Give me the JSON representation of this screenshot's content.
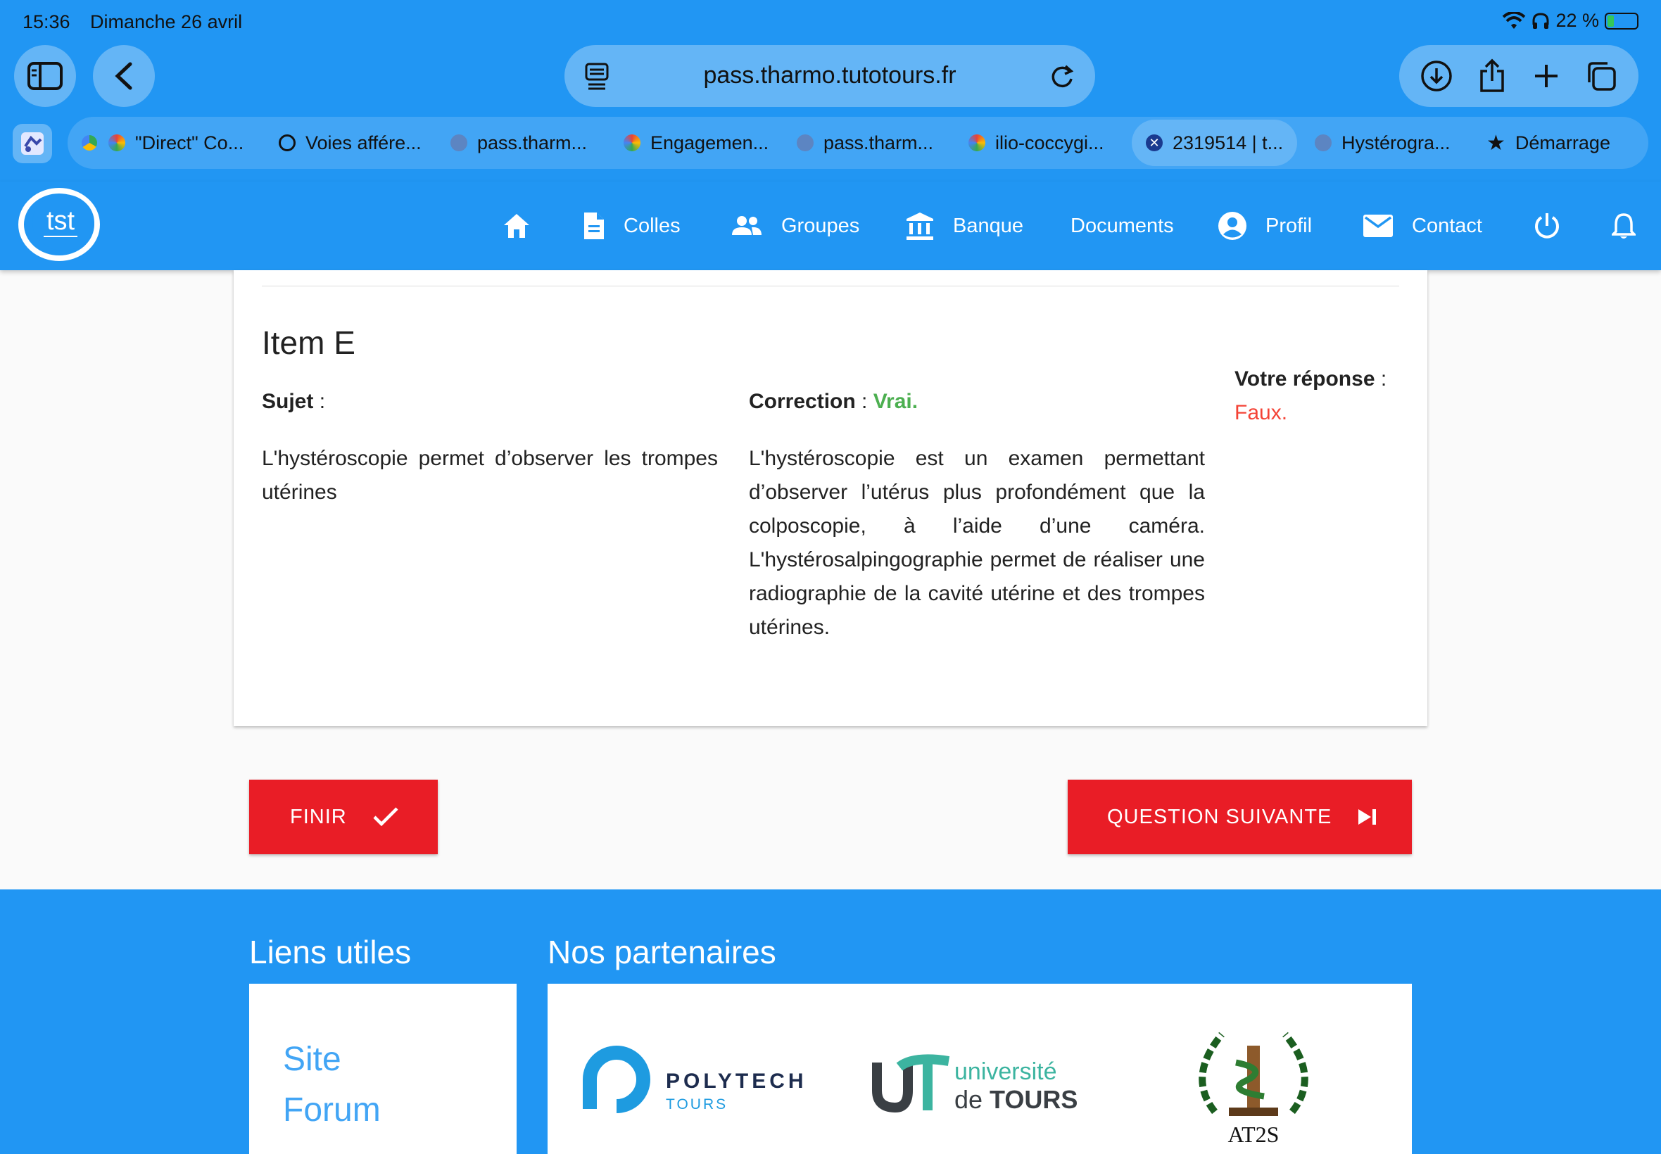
{
  "status": {
    "time": "15:36",
    "date": "Dimanche 26 avril",
    "battery": "22 %",
    "battery_level": 0.22
  },
  "browser": {
    "url": "pass.tharmo.tutotours.fr",
    "tabs": [
      {
        "label": "",
        "favicon": "drive-icon"
      },
      {
        "label": "\"Direct\" Co...",
        "favicon": "gemini-icon"
      },
      {
        "label": "Voies affére...",
        "favicon": "openai-icon"
      },
      {
        "label": "pass.tharm...",
        "favicon": "site-icon"
      },
      {
        "label": "Engagemen...",
        "favicon": "gemini-icon"
      },
      {
        "label": "pass.tharm...",
        "favicon": "site-icon"
      },
      {
        "label": "ilio-coccygi...",
        "favicon": "gemini-icon"
      },
      {
        "label": "2319514 | t...",
        "favicon": "close-icon",
        "active": true
      },
      {
        "label": "Hystérogra...",
        "favicon": "site-icon"
      },
      {
        "label": "Démarrage",
        "favicon": "star-icon"
      }
    ]
  },
  "nav": {
    "items": [
      {
        "id": "home",
        "label": ""
      },
      {
        "id": "colles",
        "label": "Colles"
      },
      {
        "id": "groupes",
        "label": "Groupes"
      },
      {
        "id": "banque",
        "label": "Banque"
      },
      {
        "id": "documents",
        "label": "Documents"
      },
      {
        "id": "profil",
        "label": "Profil"
      },
      {
        "id": "contact",
        "label": "Contact"
      }
    ]
  },
  "question": {
    "title": "Item E",
    "subject_label": "Sujet",
    "subject_text": "L'hystéroscopie permet d’observer les trompes utérines",
    "correction_label": "Correction",
    "correction_value": "Vrai.",
    "correction_text": "L'hystéroscopie est un examen permettant d’observer l’utérus plus profondément que la colposcopie, à l’aide d’une caméra. L'hystérosalpingographie permet de réaliser une radiographie de la cavité utérine et des trompes utérines.",
    "answer_label": "Votre réponse",
    "answer_value": "Faux.",
    "sep": " :",
    "sep2": " : "
  },
  "actions": {
    "finish_label": "FINIR",
    "next_label": "QUESTION SUIVANTE"
  },
  "footer": {
    "links_title": "Liens utiles",
    "partners_title": "Nos partenaires",
    "links": [
      "Site",
      "Forum"
    ],
    "partners": {
      "polytech": {
        "name": "POLYTECH",
        "sub": "TOURS"
      },
      "univ": {
        "line1": "université",
        "line2_a": "de ",
        "line2_b": "TOURS"
      },
      "at2s": "AT2S"
    }
  },
  "colors": {
    "primary": "#2196f3",
    "danger": "#e91d26",
    "success": "#4caf50",
    "error": "#f44336"
  }
}
